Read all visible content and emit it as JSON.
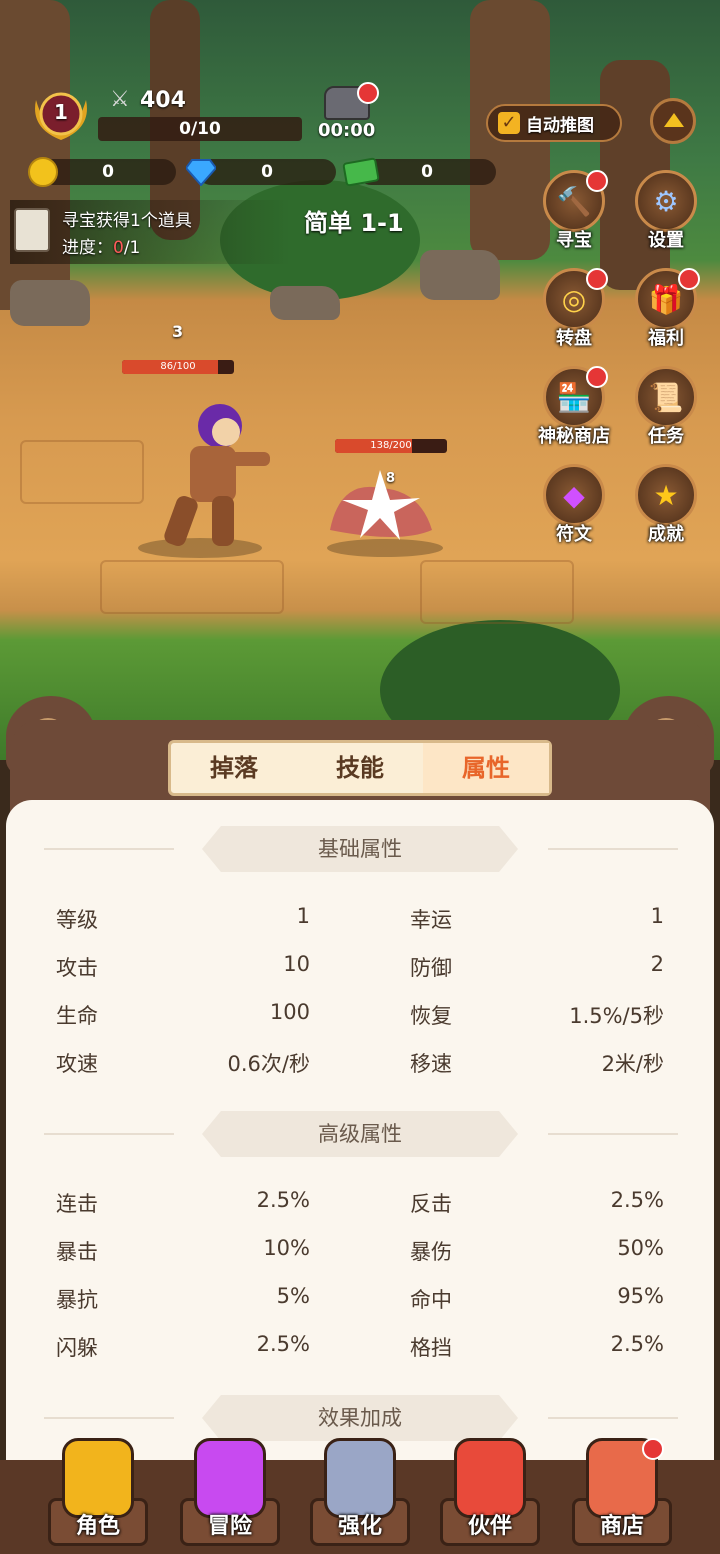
{
  "hud": {
    "level": "1",
    "power": "404",
    "exp": "0/10",
    "timer": "00:00",
    "auto_push_label": "自动推图",
    "gold": "0",
    "diamond": "0",
    "cash": "0"
  },
  "quest": {
    "title": "寻宝获得1个道具",
    "progress_label": "进度：",
    "progress_current": "0",
    "progress_total": "/1"
  },
  "stage": "简单 1-1",
  "side_buttons": [
    {
      "label": "寻宝",
      "icon": "hammer-icon"
    },
    {
      "label": "设置",
      "icon": "gear-icon"
    },
    {
      "label": "转盘",
      "icon": "wheel-icon"
    },
    {
      "label": "福利",
      "icon": "gift-icon"
    },
    {
      "label": "神秘商店",
      "icon": "shop-icon"
    },
    {
      "label": "任务",
      "icon": "scroll-icon"
    },
    {
      "label": "符文",
      "icon": "gem-icon"
    },
    {
      "label": "成就",
      "icon": "star-icon"
    }
  ],
  "battle": {
    "player_level": "3",
    "player_hp": "86/100",
    "player_hp_fraction": 0.86,
    "enemy_hp": "138/200",
    "enemy_hp_fraction": 0.69,
    "damage": "8"
  },
  "tabs": [
    "掉落",
    "技能",
    "属性"
  ],
  "active_tab": "属性",
  "sections": {
    "basic_title": "基础属性",
    "advanced_title": "高级属性",
    "effect_title": "效果加成"
  },
  "basic": [
    {
      "k1": "等级",
      "v1": "1",
      "k2": "幸运",
      "v2": "1"
    },
    {
      "k1": "攻击",
      "v1": "10",
      "k2": "防御",
      "v2": "2"
    },
    {
      "k1": "生命",
      "v1": "100",
      "k2": "恢复",
      "v2": "1.5%/5秒"
    },
    {
      "k1": "攻速",
      "v1": "0.6次/秒",
      "k2": "移速",
      "v2": "2米/秒"
    }
  ],
  "advanced": [
    {
      "k1": "连击",
      "v1": "2.5%",
      "k2": "反击",
      "v2": "2.5%"
    },
    {
      "k1": "暴击",
      "v1": "10%",
      "k2": "暴伤",
      "v2": "50%"
    },
    {
      "k1": "暴抗",
      "v1": "5%",
      "k2": "命中",
      "v2": "95%"
    },
    {
      "k1": "闪躲",
      "v1": "2.5%",
      "k2": "格挡",
      "v2": "2.5%"
    }
  ],
  "bottom_nav": [
    {
      "label": "角色",
      "icon": "armor-icon"
    },
    {
      "label": "冒险",
      "icon": "portal-icon"
    },
    {
      "label": "强化",
      "icon": "anvil-icon"
    },
    {
      "label": "伙伴",
      "icon": "companions-icon"
    },
    {
      "label": "商店",
      "icon": "store-icon"
    }
  ],
  "colors": {
    "accent": "#e8662a",
    "hp": "#d94a2c",
    "badge": "#e53636"
  }
}
